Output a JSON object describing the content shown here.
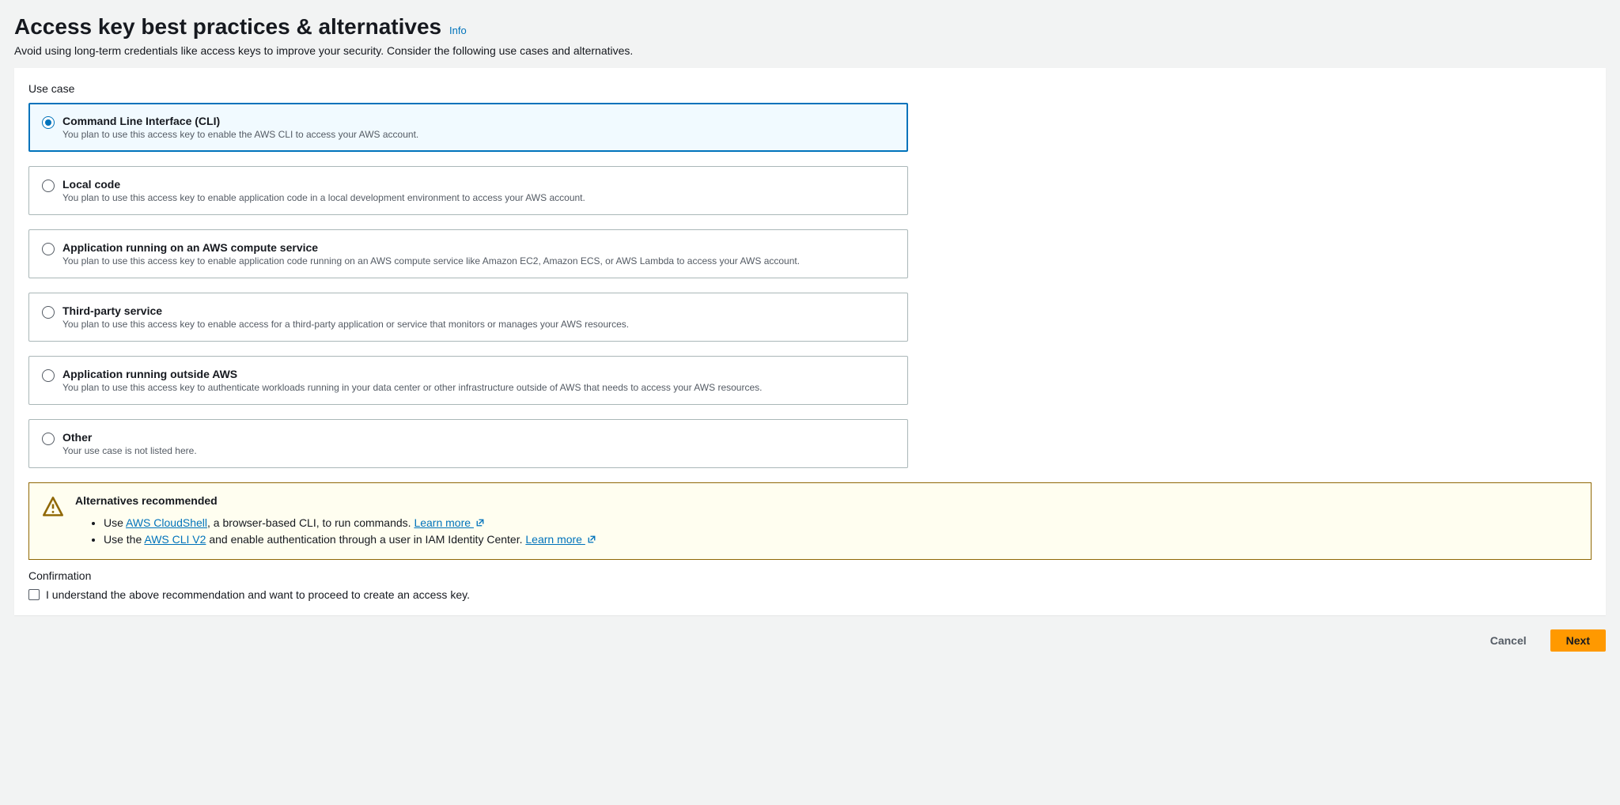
{
  "header": {
    "title": "Access key best practices & alternatives",
    "info": "Info",
    "subtitle": "Avoid using long-term credentials like access keys to improve your security. Consider the following use cases and alternatives."
  },
  "usecase_label": "Use case",
  "options": [
    {
      "title": "Command Line Interface (CLI)",
      "desc": "You plan to use this access key to enable the AWS CLI to access your AWS account.",
      "selected": true
    },
    {
      "title": "Local code",
      "desc": "You plan to use this access key to enable application code in a local development environment to access your AWS account.",
      "selected": false
    },
    {
      "title": "Application running on an AWS compute service",
      "desc": "You plan to use this access key to enable application code running on an AWS compute service like Amazon EC2, Amazon ECS, or AWS Lambda to access your AWS account.",
      "selected": false
    },
    {
      "title": "Third-party service",
      "desc": "You plan to use this access key to enable access for a third-party application or service that monitors or manages your AWS resources.",
      "selected": false
    },
    {
      "title": "Application running outside AWS",
      "desc": "You plan to use this access key to authenticate workloads running in your data center or other infrastructure outside of AWS that needs to access your AWS resources.",
      "selected": false
    },
    {
      "title": "Other",
      "desc": "Your use case is not listed here.",
      "selected": false
    }
  ],
  "alert": {
    "title": "Alternatives recommended",
    "line1_pre": "Use ",
    "line1_link1": "AWS CloudShell",
    "line1_mid": ", a browser-based CLI, to run commands. ",
    "line1_learn": "Learn more ",
    "line2_pre": "Use the ",
    "line2_link1": "AWS CLI V2",
    "line2_mid": " and enable authentication through a user in IAM Identity Center. ",
    "line2_learn": "Learn more "
  },
  "confirmation": {
    "label": "Confirmation",
    "text": "I understand the above recommendation and want to proceed to create an access key."
  },
  "footer": {
    "cancel": "Cancel",
    "next": "Next"
  }
}
